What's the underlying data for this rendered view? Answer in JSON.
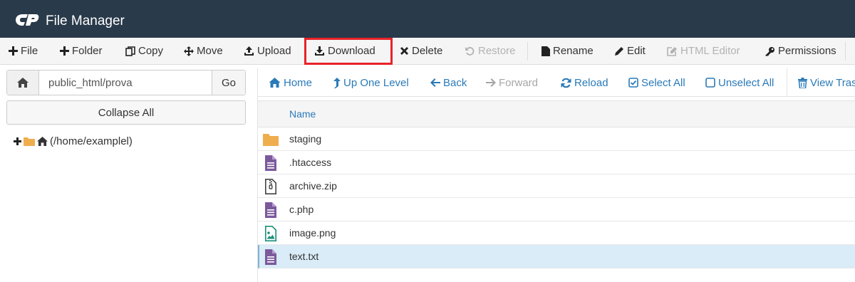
{
  "app": {
    "title": "File Manager"
  },
  "toolbar": {
    "file": "File",
    "folder": "Folder",
    "copy": "Copy",
    "move": "Move",
    "upload": "Upload",
    "download": "Download",
    "delete": "Delete",
    "restore": "Restore",
    "rename": "Rename",
    "edit": "Edit",
    "html_editor": "HTML Editor",
    "permissions": "Permissions"
  },
  "sidebar": {
    "path_value": "public_html/prova",
    "go_label": "Go",
    "collapse_label": "Collapse All",
    "tree_root": "(/home/examplel)"
  },
  "navbar": {
    "home": "Home",
    "up_one_level": "Up One Level",
    "back": "Back",
    "forward": "Forward",
    "reload": "Reload",
    "select_all": "Select All",
    "unselect_all": "Unselect All",
    "view_trash": "View Trash"
  },
  "table": {
    "column_name": "Name",
    "files": [
      {
        "name": "staging",
        "icon": "folder-icon"
      },
      {
        "name": ".htaccess",
        "icon": "text-file-icon"
      },
      {
        "name": "archive.zip",
        "icon": "zip-file-icon"
      },
      {
        "name": "c.php",
        "icon": "text-file-icon"
      },
      {
        "name": "image.png",
        "icon": "image-file-icon"
      },
      {
        "name": "text.txt",
        "icon": "text-file-icon",
        "selected": true
      }
    ]
  },
  "colors": {
    "titlebar": "#293a4a",
    "link": "#2a7ab8",
    "highlight": "#e8232a",
    "folder": "#f0ad4e",
    "file_purple": "#7b5a9c",
    "file_teal": "#1a8f7a",
    "selected_row": "#d9ecf7"
  }
}
